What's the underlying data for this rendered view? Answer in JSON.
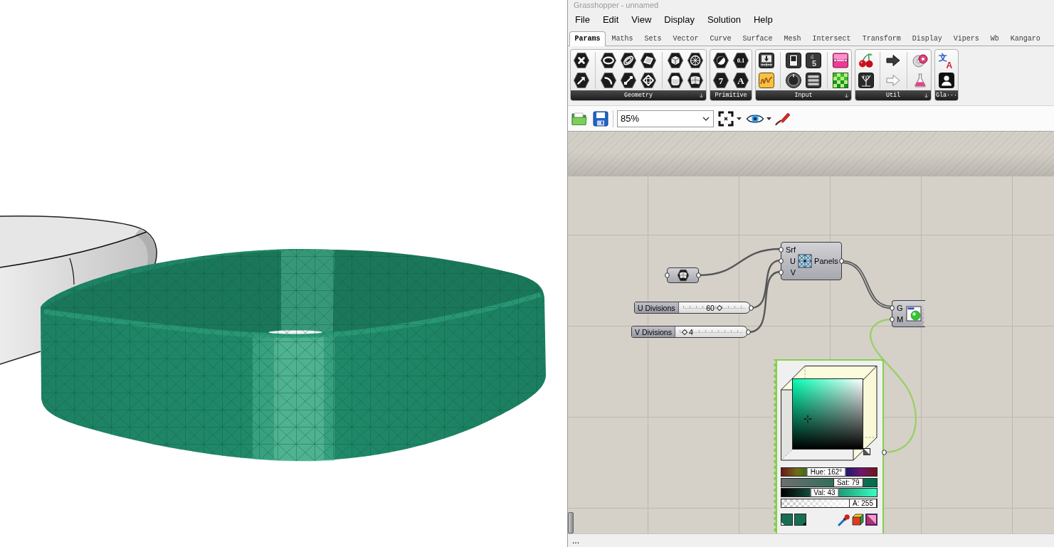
{
  "window": {
    "title": "Grasshopper - unnamed"
  },
  "menu": [
    "File",
    "Edit",
    "View",
    "Display",
    "Solution",
    "Help"
  ],
  "tabs": [
    {
      "label": "Params",
      "selected": true
    },
    {
      "label": "Maths",
      "selected": false
    },
    {
      "label": "Sets",
      "selected": false
    },
    {
      "label": "Vector",
      "selected": false
    },
    {
      "label": "Curve",
      "selected": false
    },
    {
      "label": "Surface",
      "selected": false
    },
    {
      "label": "Mesh",
      "selected": false
    },
    {
      "label": "Intersect",
      "selected": false
    },
    {
      "label": "Transform",
      "selected": false
    },
    {
      "label": "Display",
      "selected": false
    },
    {
      "label": "Vipers",
      "selected": false
    },
    {
      "label": "Wb",
      "selected": false
    },
    {
      "label": "Kangaro",
      "selected": false
    }
  ],
  "ribbon": [
    {
      "label": "Geometry",
      "expander": true
    },
    {
      "label": "Primitive",
      "expander": false,
      "icon_texts": [
        "0.1",
        "7",
        "A"
      ]
    },
    {
      "label": "Input",
      "expander": true,
      "icon_texts": [
        "4",
        "5"
      ]
    },
    {
      "label": "Util",
      "expander": true
    },
    {
      "label": "Gla···",
      "expander": false,
      "icon_texts": [
        "文",
        "A"
      ]
    }
  ],
  "toolbar": {
    "zoom": "85%"
  },
  "canvas": {
    "parameter": {
      "selected": false
    },
    "component": {
      "inputs": [
        "Srf",
        "U",
        "V"
      ],
      "output": "Panels",
      "selected": false
    },
    "sliders": [
      {
        "label": "U Divisions",
        "value": "60",
        "level": 0.58,
        "selected": false
      },
      {
        "label": "V Divisions",
        "value": "4",
        "level": 0.08,
        "selected": false
      }
    ],
    "preview": {
      "inputs": [
        "G",
        "M"
      ],
      "selected": false
    },
    "swatch": {
      "selected": true,
      "sliders": [
        {
          "kind": "hue",
          "label": "Hue: 162°",
          "level": 0.45
        },
        {
          "kind": "saturation",
          "label": "Sat: 79",
          "level": 0.79
        },
        {
          "kind": "value",
          "label": "Val: 43",
          "level": 0.43
        },
        {
          "kind": "alpha",
          "label": "A: 255",
          "level": 1
        }
      ]
    }
  },
  "status_bar": {
    "text": "..."
  }
}
